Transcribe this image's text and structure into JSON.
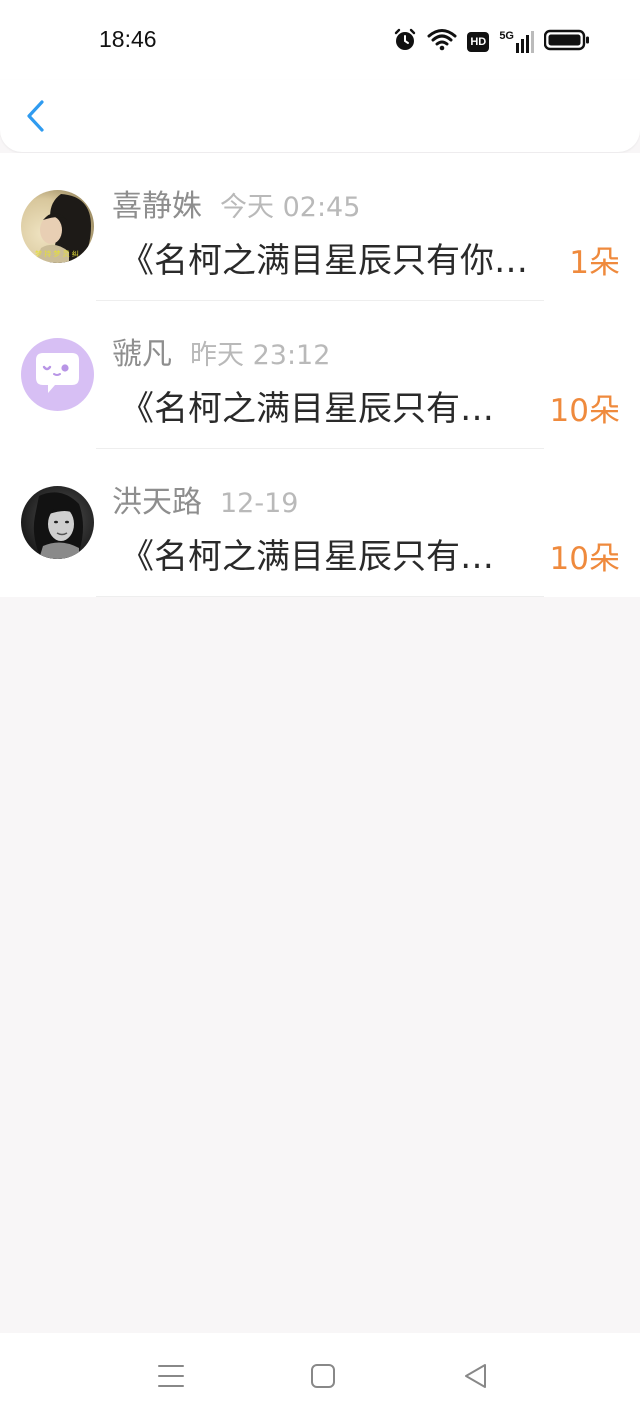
{
  "status_bar": {
    "time": "18:46",
    "icons": [
      "alarm-icon",
      "wifi-icon",
      "hd-icon",
      "signal-5g-icon",
      "battery-icon"
    ],
    "hd_label": "HD",
    "network_label": "5G"
  },
  "header": {
    "back_icon": "chevron-left-icon",
    "accent_color": "#2f9bf0"
  },
  "items": [
    {
      "name": "喜静姝",
      "time": "今天 02:45",
      "title": "《名柯之满目星辰只有你…",
      "amount": "1朵",
      "avatar": "avatar-photo-dark-hair"
    },
    {
      "name": "虢凡",
      "time": "昨天 23:12",
      "title": "《名柯之满目星辰只有…",
      "amount": "10朵",
      "avatar": "avatar-purple-chat-bubble"
    },
    {
      "name": "洪天路",
      "time": "12-19",
      "title": "《名柯之满目星辰只有…",
      "amount": "10朵",
      "avatar": "avatar-photo-bw-portrait"
    }
  ],
  "nav_bar": {
    "icons": [
      "menu-icon",
      "home-square-icon",
      "back-triangle-icon"
    ]
  },
  "colors": {
    "amount": "#ef8a3d",
    "name": "#8e8e8e",
    "time": "#b9b9b9",
    "title": "#2a2a2a",
    "page_bg": "#f8f6f7"
  }
}
